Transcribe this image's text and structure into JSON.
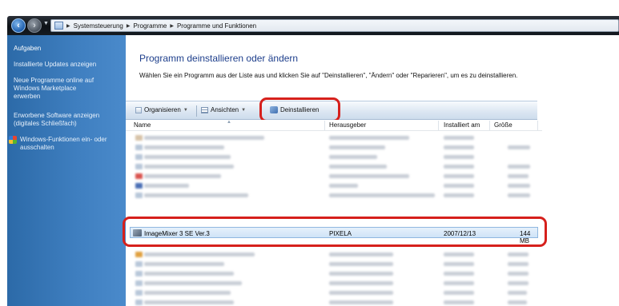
{
  "address_bar": {
    "back_icon": "back-arrow-icon",
    "forward_icon": "forward-arrow-icon",
    "crumbs": [
      "Systemsteuerung",
      "Programme",
      "Programme und Funktionen"
    ]
  },
  "left_panel": {
    "heading": "Aufgaben",
    "tasks": [
      "Installierte Updates anzeigen",
      "Neue Programme online auf",
      "Windows Marketplace",
      "erwerben",
      "Erworbene Software anzeigen",
      "(digitales Schließfach)",
      "Windows-Funktionen ein- oder",
      "ausschalten"
    ]
  },
  "main": {
    "title": "Programm deinstallieren oder ändern",
    "description": "Wählen Sie ein Programm aus der Liste aus und klicken Sie auf \"Deinstallieren\", \"Ändern\" oder \"Reparieren\", um es zu deinstallieren."
  },
  "toolbar": {
    "organize_label": "Organisieren",
    "views_label": "Ansichten",
    "uninstall_label": "Deinstallieren"
  },
  "table": {
    "columns": [
      "Name",
      "Herausgeber",
      "Installiert am",
      "Größe"
    ],
    "selected_row": {
      "name": "ImageMixer 3 SE Ver.3",
      "publisher": "PIXELA",
      "installed": "2007/12/13",
      "size": "144 MB"
    }
  },
  "colors": {
    "highlight": "#d6201c",
    "sidebar": "#3f7fc0",
    "title": "#1e3f8c"
  }
}
